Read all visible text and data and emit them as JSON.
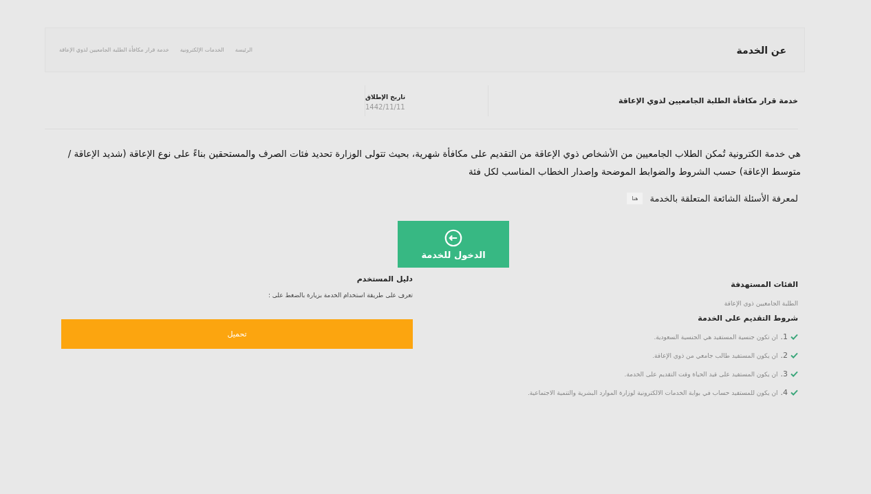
{
  "header": {
    "title": "عن الخدمة",
    "breadcrumb": [
      "الرئيسة",
      "الخدمات الإلكترونية",
      "خدمة قرار مكافأة الطلبة الجامعيين لذوي الإعاقة"
    ]
  },
  "service": {
    "name": "خدمة قرار مكافأة الطلبة الجامعيين لذوي الإعاقة",
    "launch_label": "تاريخ الإطلاق",
    "launch_date": "1442/11/11"
  },
  "description": "هي خدمة الكترونية تُمكن الطلاب الجامعيين من الأشخاص ذوي الإعاقة من التقديم على مكافأة شهرية، بحيث تتولى الوزارة تحديد فئات الصرف والمستحقين بناءً على نوع الإعاقة (شديد الإعاقة / متوسط الإعاقة) حسب الشروط والضوابط الموضحة وإصدار الخطاب المناسب لكل فئة",
  "faq": {
    "text": "لمعرفة الأسئلة الشائعة المتعلقة بالخدمة",
    "link": "هنا"
  },
  "enter_button": "الدخول للخدمة",
  "targets": {
    "title": "الفئات المستهدفة",
    "text": "الطلبة الجامعيين ذوي الإعاقة"
  },
  "conditions": {
    "title": "شروط التقديم على الخدمة",
    "items": [
      {
        "number": "1.",
        "text": "ان تكون جنسية المستفيد هي الجنسية السعودية."
      },
      {
        "number": "2.",
        "text": "ان يكون المستفيد طالب جامعي من ذوي الإعاقة."
      },
      {
        "number": "3.",
        "text": "ان يكون المستفيد على قيد الحياة وقت التقديم على الخدمة."
      },
      {
        "number": "4.",
        "text": "ان يكون للمستفيد حساب في بوابة الخدمات الالكترونية لوزارة الموارد البشرية والتنمية الاجتماعية."
      }
    ]
  },
  "guide": {
    "title": "دليل المستخدم",
    "text": "تعرف على طريقة استخدام الخدمة بزيارة بالضغط على :",
    "button": "تحميل"
  }
}
